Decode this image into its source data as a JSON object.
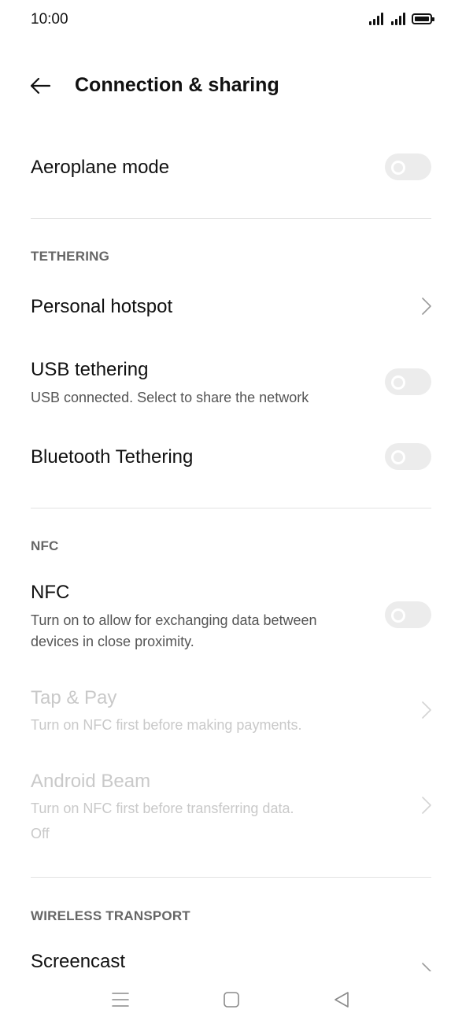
{
  "status_bar": {
    "time": "10:00"
  },
  "header": {
    "title": "Connection & sharing"
  },
  "rows": {
    "aeroplane": {
      "title": "Aeroplane mode"
    },
    "hotspot": {
      "title": "Personal hotspot"
    },
    "usb": {
      "title": "USB tethering",
      "subtitle": "USB connected. Select to share the network"
    },
    "bluetooth": {
      "title": "Bluetooth Tethering"
    },
    "nfc": {
      "title": "NFC",
      "subtitle_line1": "Turn on to allow for exchanging data between",
      "subtitle_line2": "devices in close proximity."
    },
    "tap_pay": {
      "title": "Tap & Pay",
      "subtitle": "Turn on NFC first before making payments."
    },
    "android_beam": {
      "title": "Android Beam",
      "subtitle": "Turn on NFC first before transferring data.",
      "status": "Off"
    },
    "screencast": {
      "title": "Screencast"
    }
  },
  "sections": {
    "tethering": "TETHERING",
    "nfc": "NFC",
    "wireless_transport": "WIRELESS TRANSPORT"
  },
  "toggles": {
    "aeroplane": false,
    "usb": false,
    "bluetooth": false,
    "nfc": false
  },
  "colors": {
    "toggle_off": "#ececec",
    "disabled_text": "#c9c9c9",
    "divider": "#e2e2e2"
  },
  "nav_bar": {
    "icons": [
      "menu-icon",
      "home-icon",
      "back-icon"
    ]
  }
}
